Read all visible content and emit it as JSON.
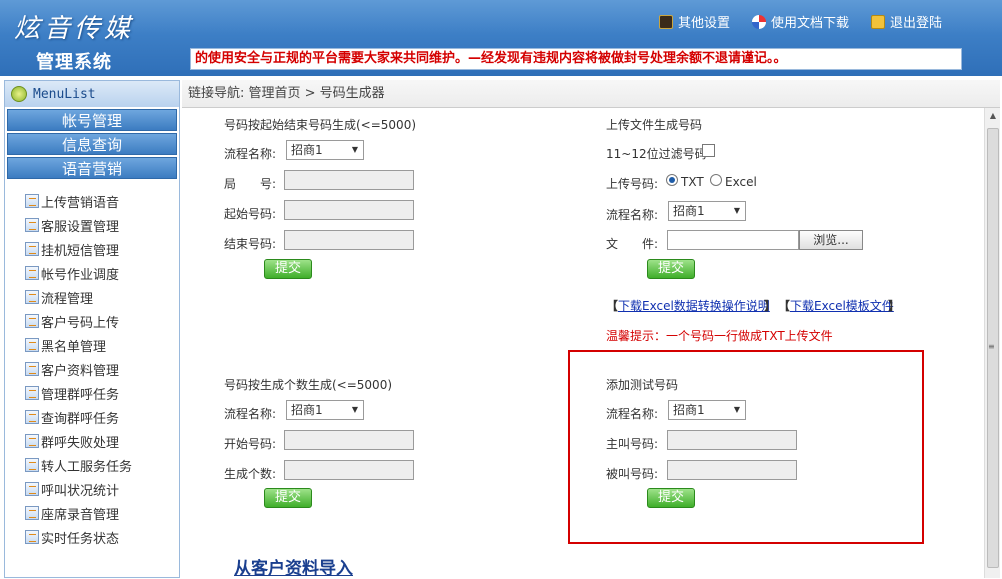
{
  "header": {
    "logo": "炫音传媒",
    "system_title": "管理系统",
    "links": [
      {
        "label": "其他设置",
        "icon": "settings-icon"
      },
      {
        "label": "使用文档下载",
        "icon": "download-icon"
      },
      {
        "label": "退出登陆",
        "icon": "lock-icon"
      }
    ],
    "marquee": "的使用安全与正规的平台需要大家来共同维护。—经发现有违规内容将被做封号处理余额不退请谨记。。"
  },
  "sidebar": {
    "header": "MenuList",
    "groups": [
      "帐号管理",
      "信息查询",
      "语音营销"
    ],
    "items": [
      "上传营销语音",
      "客服设置管理",
      "挂机短信管理",
      "帐号作业调度",
      "流程管理",
      "客户号码上传",
      "黑名单管理",
      "客户资料管理",
      "管理群呼任务",
      "查询群呼任务",
      "群呼失败处理",
      "转人工服务任务",
      "呼叫状况统计",
      "座席录音管理",
      "实时任务状态"
    ]
  },
  "breadcrumb": "链接导航: 管理首页 > 号码生成器",
  "range_form": {
    "title": "号码按起始结束号码生成(<=5000)",
    "flow_label": "流程名称:",
    "flow_value": "招商1",
    "office_label": "局　　号:",
    "start_label": "起始号码:",
    "end_label": "结束号码:",
    "submit": "提交"
  },
  "upload_form": {
    "title": "上传文件生成号码",
    "filter_label": "11~12位过滤号码",
    "upload_label": "上传号码:",
    "txt_option": "TXT",
    "excel_option": "Excel",
    "flow_label": "流程名称:",
    "flow_value": "招商1",
    "file_label": "文　　件:",
    "browse": "浏览...",
    "submit": "提交",
    "bracket_open": "【",
    "bracket_close": "】",
    "download_doc": "下载Excel数据转换操作说明",
    "download_template": "下载Excel模板文件",
    "tip": "温馨提示：一个号码一行做成TXT上传文件"
  },
  "count_form": {
    "title": "号码按生成个数生成(<=5000)",
    "flow_label": "流程名称:",
    "flow_value": "招商1",
    "start_label": "开始号码:",
    "count_label": "生成个数:",
    "submit": "提交"
  },
  "test_form": {
    "title": "添加测试号码",
    "flow_label": "流程名称:",
    "flow_value": "招商1",
    "caller_label": "主叫号码:",
    "callee_label": "被叫号码:",
    "submit": "提交"
  },
  "import_link": "从客户资料导入",
  "colors": {
    "header_blue": "#3d7fc6",
    "marquee_red": "#d40000",
    "submit_green": "#3fae2a"
  }
}
